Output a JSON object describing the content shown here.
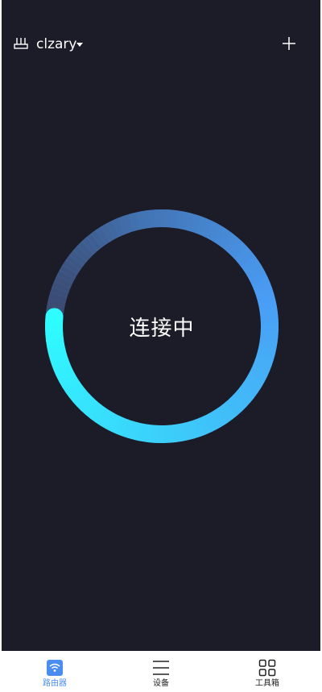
{
  "header": {
    "router_icon": "router-icon",
    "device_name": "clzary",
    "dropdown_icon": "caret-down-icon",
    "add_icon": "plus-icon"
  },
  "status": {
    "text": "连接中",
    "progress": 0.75,
    "colors": {
      "start": "#2ffcff",
      "mid": "#4a9df5",
      "end": "#3c4e78"
    }
  },
  "bottom_nav": {
    "items": [
      {
        "label": "路由器",
        "icon": "wifi-icon",
        "active": true
      },
      {
        "label": "设备",
        "icon": "menu-lines-icon",
        "active": false
      },
      {
        "label": "工具箱",
        "icon": "grid-icon",
        "active": false
      }
    ],
    "active_color": "#4a8cf0"
  }
}
